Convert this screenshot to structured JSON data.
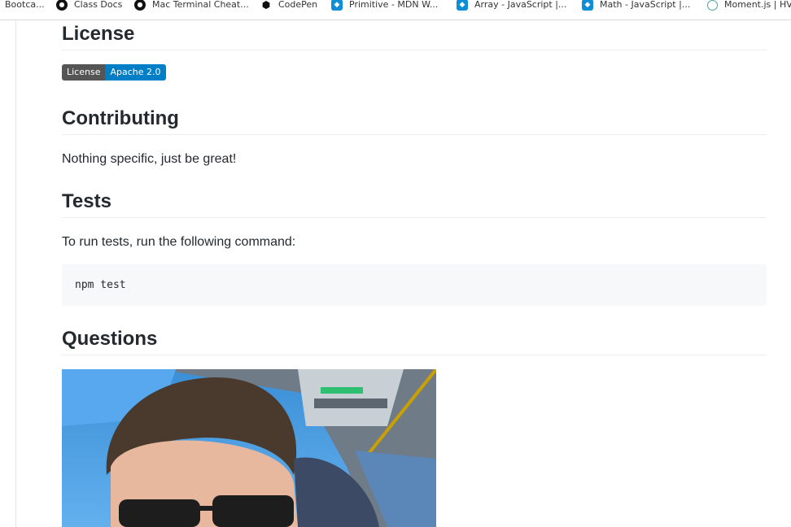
{
  "bookmarks": [
    {
      "label": "Bootca...",
      "icon": "none"
    },
    {
      "label": "Class Docs",
      "icon": "github-icon"
    },
    {
      "label": "Mac Terminal Cheat...",
      "icon": "github-icon"
    },
    {
      "label": "CodePen",
      "icon": "codepen-icon"
    },
    {
      "label": "Primitive - MDN W...",
      "icon": "mdn-icon"
    },
    {
      "label": "Array - JavaScript |...",
      "icon": "mdn-icon"
    },
    {
      "label": "Math - JavaScript |...",
      "icon": "mdn-icon"
    },
    {
      "label": "Moment.js | HV",
      "icon": "clock-icon"
    }
  ],
  "license": {
    "heading": "License",
    "badge_label": "License",
    "badge_value": "Apache 2.0"
  },
  "contributing": {
    "heading": "Contributing",
    "text": "Nothing specific, just be great!"
  },
  "tests": {
    "heading": "Tests",
    "text": "To run tests, run the following command:",
    "command": "npm test"
  },
  "questions": {
    "heading": "Questions"
  },
  "colors": {
    "badge_label_bg": "#555555",
    "badge_value_bg": "#007ec6",
    "code_bg": "#f6f8fa"
  }
}
